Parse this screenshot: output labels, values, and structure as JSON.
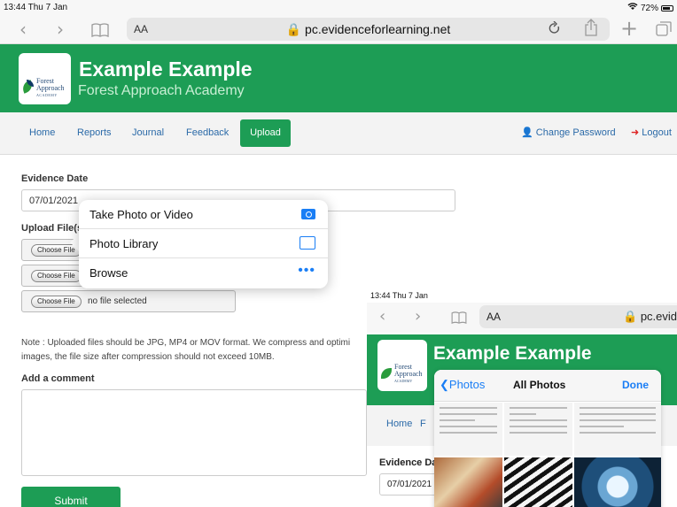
{
  "status": {
    "time": "13:44  Thu 7 Jan",
    "battery": "72%"
  },
  "browser": {
    "aa": "AA",
    "url": "pc.evidenceforlearning.net"
  },
  "header": {
    "logo": [
      "Forest",
      "Approach",
      "ACADEMY"
    ],
    "title": "Example Example",
    "subtitle": "Forest Approach Academy"
  },
  "nav": {
    "items": [
      "Home",
      "Reports",
      "Journal",
      "Feedback"
    ],
    "active": "Upload",
    "change_password": "Change Password",
    "logout": "Logout"
  },
  "form": {
    "evidence_date_label": "Evidence Date",
    "evidence_date_value": "07/01/2021",
    "upload_label": "Upload File(s",
    "file_btn": "Choose File",
    "file_status": "no file selected",
    "note": "Note : Uploaded files should be JPG, MP4 or MOV format. We compress and optimi",
    "note2": "images, the file size after compression should not exceed 10MB.",
    "comment_label": "Add a comment",
    "submit": "Submit"
  },
  "popover": {
    "items": [
      "Take Photo or Video",
      "Photo Library",
      "Browse"
    ],
    "icons": [
      "camera-icon",
      "photo-library-icon",
      "more-icon"
    ]
  },
  "inset": {
    "time": "13:44  Thu 7 Jan",
    "aa": "AA",
    "url": "pc.evider",
    "title": "Example Example",
    "logo": [
      "Forest",
      "Approach",
      "ACADEMY"
    ],
    "nav_home": "Home",
    "nav_next": "F",
    "date_label": "Evidence Dat",
    "date_value": "07/01/2021",
    "picker": {
      "back": "Photos",
      "title": "All Photos",
      "done": "Done"
    }
  }
}
